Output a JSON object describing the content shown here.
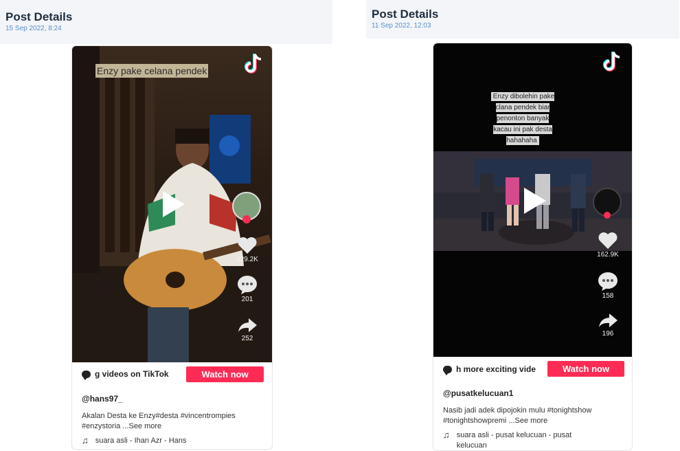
{
  "left": {
    "title": "Post Details",
    "date": "15 Sep 2022, 8:24",
    "caption": "Enzy pake celana pendek",
    "likes": "329.2K",
    "comments": "201",
    "shares": "252",
    "banner_text": "g videos on TikTok",
    "watch_label": "Watch now",
    "username": "@hans97_",
    "description": "Akalan Desta ke Enzy#desta #vincentrompies #enzystoria ...See more",
    "music": "suara asli - Ihan Azr - Hans"
  },
  "right": {
    "title": "Post Details",
    "date": "11 Sep 2022, 12:03",
    "caption": "Enzy dibolehin pake clana pendek biar penonton banyak kacau ini pak desta hahahaha",
    "likes": "162.9K",
    "comments": "158",
    "shares": "196",
    "banner_text": "h more exciting vide",
    "watch_label": "Watch now",
    "username": "@pusatkelucuan1",
    "description": "Nasib jadi adek dipojokin mulu  #tonightshow #tonightshowpremi ...See more",
    "music": "suara asli - pusat kelucuan - pusat kelucuan"
  },
  "colors": {
    "accent": "#fe2c55",
    "date": "#5b8fc7",
    "header_bg": "#f3f5f9"
  },
  "icons": [
    "tiktok-logo-icon",
    "play-icon",
    "heart-icon",
    "comment-icon",
    "share-icon",
    "chat-bubble-icon",
    "music-note-icon"
  ]
}
